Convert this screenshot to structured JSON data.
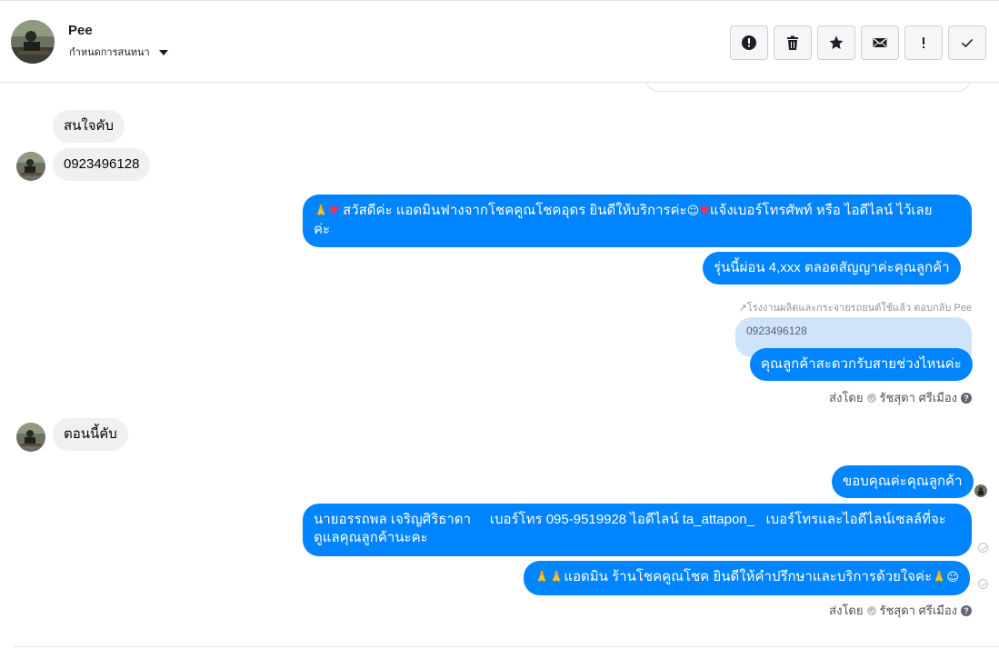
{
  "header": {
    "contact_name": "Pee",
    "subtitle": "กำหนดการสนทนา",
    "actions": [
      "alert-circle-icon",
      "trash-icon",
      "star-icon",
      "envelope-icon",
      "exclamation-icon",
      "check-icon"
    ]
  },
  "messages": {
    "m1": "สนใจคับ",
    "m2": "0923496128",
    "m3_a": "สวัสดีค่ะ แอดมินฟางจากโชคคูณโชคอุดร ยินดีให้บริการค่ะ",
    "m3_b": "แจ้งเบอร์โทรศัพท์ หรือ ไอดีไลน์  ไว้เลย",
    "m3_c": "ค่ะ",
    "m4": "รุ่นนี้ผ่อน 4,xxx ตลอดสัญญาค่ะคุณลูกค้า",
    "reply_note": "โรงงานผลิตและกระจายรถยนต์ใช้แล้ว ตอบกลับ Pee",
    "quoted": "0923496128",
    "m5": "คุณลูกค้าสะดวกรับสายช่วงไหนค่ะ",
    "sent_by_label": "ส่งโดย",
    "sent_by_name": "รัชสุดา ศรีเมือง",
    "m6": "ตอนนี้คับ",
    "m7": "ขอบคุณค่ะคุณลูกค้า",
    "m8_line1": "นายอรรถพล เจริญศิริธาดา     เบอร์โทร 095-9519928 ไอดีไลน์ ta_attapon_   เบอร์โทรและไอดีไลน์เซลล์ที่จะ",
    "m8_line2": "ดูแลคุณลูกค้านะคะ",
    "m9": "แอดมิน ร้านโชคคูณโชค ยินดีให้คำปรึกษาและบริการด้วยใจค่ะ",
    "sent_by_label2": "ส่งโดย",
    "sent_by_name2": "รัชสุดา ศรีเมือง"
  },
  "colors": {
    "outgoing": "#0084ff",
    "incoming": "#f0f0f0",
    "quoted": "#cfe3fb"
  }
}
